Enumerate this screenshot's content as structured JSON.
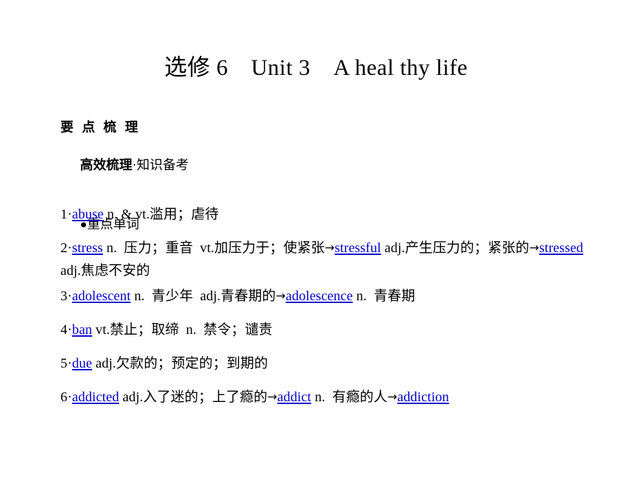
{
  "slide": {
    "title": "选修 6　Unit 3　A heal thy life",
    "heading_main": "要 点 梳 理",
    "heading_sub_bold": "高效梳理",
    "heading_sub_rest": "·知识备考",
    "heading_bullet_dot": "●",
    "heading_bullet_text": "重点单词",
    "entries": [
      {
        "number": "1",
        "separator": "·",
        "keyword": "abuse",
        "rest": " n. & vt.滥用；虐待",
        "wrapped": false
      },
      {
        "number": "2",
        "separator": "·",
        "keyword": "stress",
        "rest_part1": " n.  压力；重音  vt.加压力于；使紧张",
        "arrow1": "→",
        "keyword2": "stressful",
        "rest_part2": " adj.产生压力的；紧张的",
        "arrow2": "→",
        "keyword3": "stressed",
        "rest_part3": " adj.焦虑不安的",
        "wrapped": true
      },
      {
        "number": "3",
        "separator": "·",
        "keyword": "adolescent",
        "rest_part1": " n.  青少年  adj.青春期的",
        "arrow1": "→",
        "keyword2": "adolescence",
        "rest_part2": " n.  青春期",
        "wrapped": false
      },
      {
        "number": "4",
        "separator": "·",
        "keyword": "ban",
        "rest": " vt.禁止；取缔  n.  禁令；谴责",
        "wrapped": false
      },
      {
        "number": "5",
        "separator": "·",
        "keyword": "due",
        "rest": " adj.欠款的；预定的；到期的",
        "wrapped": false
      },
      {
        "number": "6",
        "separator": "·",
        "keyword": "addicted",
        "rest_part1": " adj.入了迷的；上了瘾的",
        "arrow1": "→",
        "keyword2": "addict",
        "rest_part2": " n.  有瘾的人",
        "arrow2": "→",
        "keyword3": "addiction",
        "wrapped": false
      }
    ],
    "colors": {
      "keyword": "#0000CC",
      "text": "#000000",
      "background": "#FFFFFF"
    }
  }
}
